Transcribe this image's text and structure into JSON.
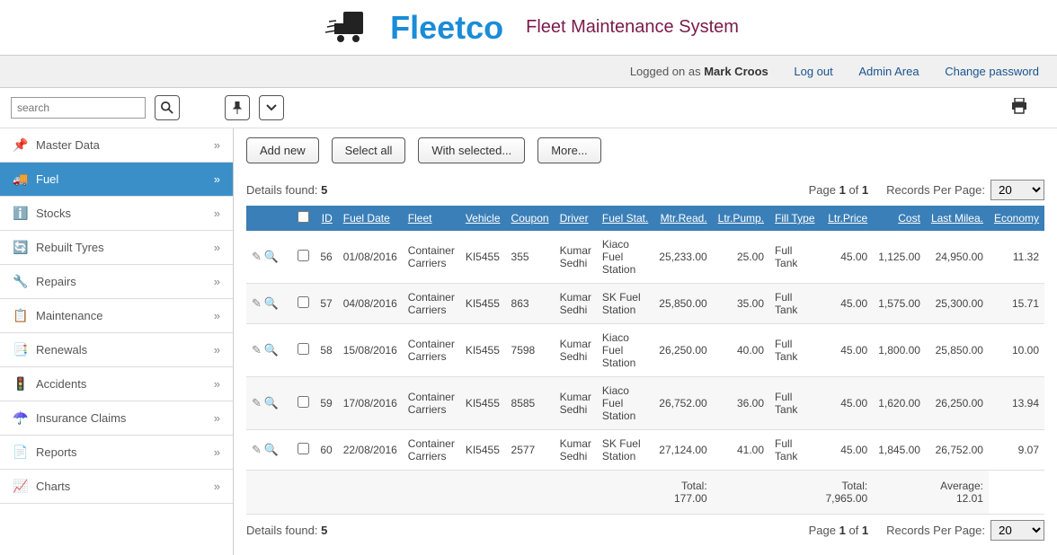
{
  "header": {
    "logo_text": "Fleetco",
    "subtitle": "Fleet Maintenance System"
  },
  "topbar": {
    "logged_prefix": "Logged on as ",
    "user": "Mark Croos",
    "logout": "Log out",
    "admin": "Admin Area",
    "change_pw": "Change password"
  },
  "search": {
    "placeholder": "search"
  },
  "sidebar": {
    "items": [
      {
        "label": "Master Data",
        "icon": "📌",
        "color": "#5a9e3e"
      },
      {
        "label": "Fuel",
        "icon": "🚚",
        "active": true
      },
      {
        "label": "Stocks",
        "icon": "ℹ️"
      },
      {
        "label": "Rebuilt Tyres",
        "icon": "🔄"
      },
      {
        "label": "Repairs",
        "icon": "🔧"
      },
      {
        "label": "Maintenance",
        "icon": "📋"
      },
      {
        "label": "Renewals",
        "icon": "📑"
      },
      {
        "label": "Accidents",
        "icon": "🚦"
      },
      {
        "label": "Insurance Claims",
        "icon": "☂️"
      },
      {
        "label": "Reports",
        "icon": "📄"
      },
      {
        "label": "Charts",
        "icon": "📈"
      }
    ]
  },
  "actions": {
    "add_new": "Add new",
    "select_all": "Select all",
    "with_selected": "With selected...",
    "more": "More..."
  },
  "info": {
    "details_label": "Details found: ",
    "details_count": "5",
    "page_prefix": "Page ",
    "page_current": "1",
    "page_of": " of ",
    "page_total": "1",
    "rpp_label": "Records Per Page:",
    "rpp_value": "20"
  },
  "table": {
    "headers": {
      "id": "ID",
      "fuel_date": "Fuel Date",
      "fleet": "Fleet",
      "vehicle": "Vehicle",
      "coupon": "Coupon",
      "driver": "Driver",
      "fuel_stat": "Fuel Stat.",
      "mtr_read": "Mtr.Read.",
      "ltr_pump": "Ltr.Pump.",
      "fill_type": "Fill Type",
      "ltr_price": "Ltr.Price",
      "cost": "Cost",
      "last_milea": "Last Milea.",
      "economy": "Economy"
    },
    "rows": [
      {
        "id": "56",
        "fuel_date": "01/08/2016",
        "fleet": "Container Carriers",
        "vehicle": "KI5455",
        "coupon": "355",
        "driver": "Kumar Sedhi",
        "fuel_stat": "Kiaco Fuel Station",
        "mtr_read": "25,233.00",
        "ltr_pump": "25.00",
        "fill_type": "Full Tank",
        "ltr_price": "45.00",
        "cost": "1,125.00",
        "last_milea": "24,950.00",
        "economy": "11.32"
      },
      {
        "id": "57",
        "fuel_date": "04/08/2016",
        "fleet": "Container Carriers",
        "vehicle": "KI5455",
        "coupon": "863",
        "driver": "Kumar Sedhi",
        "fuel_stat": "SK Fuel Station",
        "mtr_read": "25,850.00",
        "ltr_pump": "35.00",
        "fill_type": "Full Tank",
        "ltr_price": "45.00",
        "cost": "1,575.00",
        "last_milea": "25,300.00",
        "economy": "15.71"
      },
      {
        "id": "58",
        "fuel_date": "15/08/2016",
        "fleet": "Container Carriers",
        "vehicle": "KI5455",
        "coupon": "7598",
        "driver": "Kumar Sedhi",
        "fuel_stat": "Kiaco Fuel Station",
        "mtr_read": "26,250.00",
        "ltr_pump": "40.00",
        "fill_type": "Full Tank",
        "ltr_price": "45.00",
        "cost": "1,800.00",
        "last_milea": "25,850.00",
        "economy": "10.00"
      },
      {
        "id": "59",
        "fuel_date": "17/08/2016",
        "fleet": "Container Carriers",
        "vehicle": "KI5455",
        "coupon": "8585",
        "driver": "Kumar Sedhi",
        "fuel_stat": "Kiaco Fuel Station",
        "mtr_read": "26,752.00",
        "ltr_pump": "36.00",
        "fill_type": "Full Tank",
        "ltr_price": "45.00",
        "cost": "1,620.00",
        "last_milea": "26,250.00",
        "economy": "13.94"
      },
      {
        "id": "60",
        "fuel_date": "22/08/2016",
        "fleet": "Container Carriers",
        "vehicle": "KI5455",
        "coupon": "2577",
        "driver": "Kumar Sedhi",
        "fuel_stat": "SK Fuel Station",
        "mtr_read": "27,124.00",
        "ltr_pump": "41.00",
        "fill_type": "Full Tank",
        "ltr_price": "45.00",
        "cost": "1,845.00",
        "last_milea": "26,752.00",
        "economy": "9.07"
      }
    ],
    "totals": {
      "ltr_pump_label": "Total:",
      "ltr_pump_value": "177.00",
      "cost_label": "Total:",
      "cost_value": "7,965.00",
      "economy_label": "Average:",
      "economy_value": "12.01"
    }
  }
}
